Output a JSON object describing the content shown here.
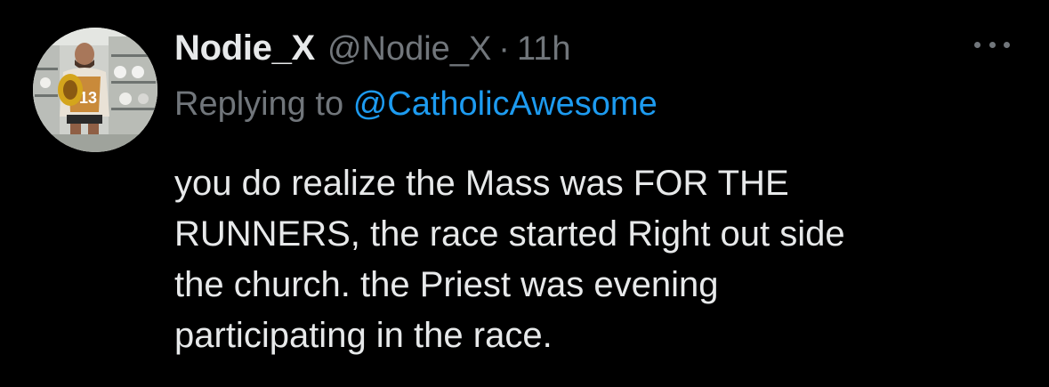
{
  "author": {
    "display_name": "Nodie_X",
    "handle": "@Nodie_X",
    "separator": "·",
    "time": "11h"
  },
  "reply": {
    "prefix": "Replying to",
    "mention": "@CatholicAwesome"
  },
  "tweet": {
    "lines": [
      "you do realize the Mass was FOR THE",
      "RUNNERS, the race started Right out side",
      "the church. the Priest was evening",
      "participating in the race."
    ]
  },
  "icons": {
    "more": "more-horizontal-icon",
    "avatar": "profile-photo"
  },
  "colors": {
    "background": "#000000",
    "text": "#e7e9ea",
    "muted": "#71767b",
    "link": "#1d9bf0"
  }
}
